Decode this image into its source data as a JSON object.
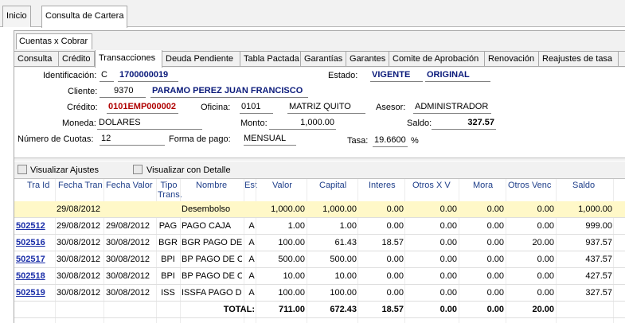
{
  "top_tabs": [
    "Inicio",
    "Consulta de Cartera"
  ],
  "subtab": "Cuentas x Cobrar",
  "tabs": [
    "Consulta",
    "Crédito",
    "Transacciones",
    "Deuda Pendiente",
    "Tabla Pactada",
    "Garantías",
    "Garantes",
    "Comite de Aprobación",
    "Renovación",
    "Reajustes de tasa"
  ],
  "active_tab": "Transacciones",
  "form": {
    "identificacion_label": "Identificación:",
    "identificacion_type": "C",
    "identificacion_value": "1700000019",
    "estado_label": "Estado:",
    "estado_value": "VIGENTE",
    "estado_value2": "ORIGINAL",
    "cliente_label": "Cliente:",
    "cliente_code": "9370",
    "cliente_name": "PARAMO PEREZ JUAN FRANCISCO",
    "credito_label": "Crédito:",
    "credito_value": "0101EMP000002",
    "oficina_label": "Oficina:",
    "oficina_code": "0101",
    "oficina_name": "MATRIZ QUITO",
    "asesor_label": "Asesor:",
    "asesor_value": "ADMINISTRADOR",
    "moneda_label": "Moneda:",
    "moneda_value": "DOLARES",
    "monto_label": "Monto:",
    "monto_value": "1,000.00",
    "saldo_label": "Saldo:",
    "saldo_value": "327.57",
    "cuotas_label": "Número de Cuotas:",
    "cuotas_value": "12",
    "forma_pago_label": "Forma de pago:",
    "forma_pago_value": "MENSUAL",
    "tasa_label": "Tasa:",
    "tasa_value": "19.6600",
    "tasa_unit": "%"
  },
  "checkboxes": {
    "ajustes": "Visualizar Ajustes",
    "detalle": "Visualizar con Detalle"
  },
  "table": {
    "headers": [
      "Tra Id",
      "Fecha Tran",
      "Fecha Valor",
      "Tipo Trans.",
      "Nombre",
      "Est",
      "Valor",
      "Capital",
      "Interes",
      "Otros X V",
      "Mora",
      "Otros Venc",
      "Saldo"
    ],
    "rows": [
      {
        "id": "",
        "fecha_tran": "29/08/2012",
        "fecha_valor": "",
        "tipo": "",
        "nombre": "Desembolso",
        "est": "",
        "valor": "1,000.00",
        "capital": "1,000.00",
        "interes": "0.00",
        "otros_xv": "0.00",
        "mora": "0.00",
        "otros_venc": "0.00",
        "saldo": "1,000.00"
      },
      {
        "id": "502512",
        "fecha_tran": "29/08/2012",
        "fecha_valor": "29/08/2012",
        "tipo": "PAG",
        "nombre": "PAGO CAJA",
        "est": "A",
        "valor": "1.00",
        "capital": "1.00",
        "interes": "0.00",
        "otros_xv": "0.00",
        "mora": "0.00",
        "otros_venc": "0.00",
        "saldo": "999.00"
      },
      {
        "id": "502516",
        "fecha_tran": "30/08/2012",
        "fecha_valor": "30/08/2012",
        "tipo": "BGR",
        "nombre": "BGR PAGO DE C",
        "est": "A",
        "valor": "100.00",
        "capital": "61.43",
        "interes": "18.57",
        "otros_xv": "0.00",
        "mora": "0.00",
        "otros_venc": "20.00",
        "saldo": "937.57"
      },
      {
        "id": "502517",
        "fecha_tran": "30/08/2012",
        "fecha_valor": "30/08/2012",
        "tipo": "BPI",
        "nombre": "BP PAGO DE CA",
        "est": "A",
        "valor": "500.00",
        "capital": "500.00",
        "interes": "0.00",
        "otros_xv": "0.00",
        "mora": "0.00",
        "otros_venc": "0.00",
        "saldo": "437.57"
      },
      {
        "id": "502518",
        "fecha_tran": "30/08/2012",
        "fecha_valor": "30/08/2012",
        "tipo": "BPI",
        "nombre": "BP PAGO DE CA",
        "est": "A",
        "valor": "10.00",
        "capital": "10.00",
        "interes": "0.00",
        "otros_xv": "0.00",
        "mora": "0.00",
        "otros_venc": "0.00",
        "saldo": "427.57"
      },
      {
        "id": "502519",
        "fecha_tran": "30/08/2012",
        "fecha_valor": "30/08/2012",
        "tipo": "ISS",
        "nombre": "ISSFA PAGO DE",
        "est": "A",
        "valor": "100.00",
        "capital": "100.00",
        "interes": "0.00",
        "otros_xv": "0.00",
        "mora": "0.00",
        "otros_venc": "0.00",
        "saldo": "327.57"
      }
    ],
    "total": {
      "label": "TOTAL:",
      "valor": "711.00",
      "capital": "672.43",
      "interes": "18.57",
      "otros_xv": "0.00",
      "mora": "0.00",
      "otros_venc": "20.00"
    }
  }
}
